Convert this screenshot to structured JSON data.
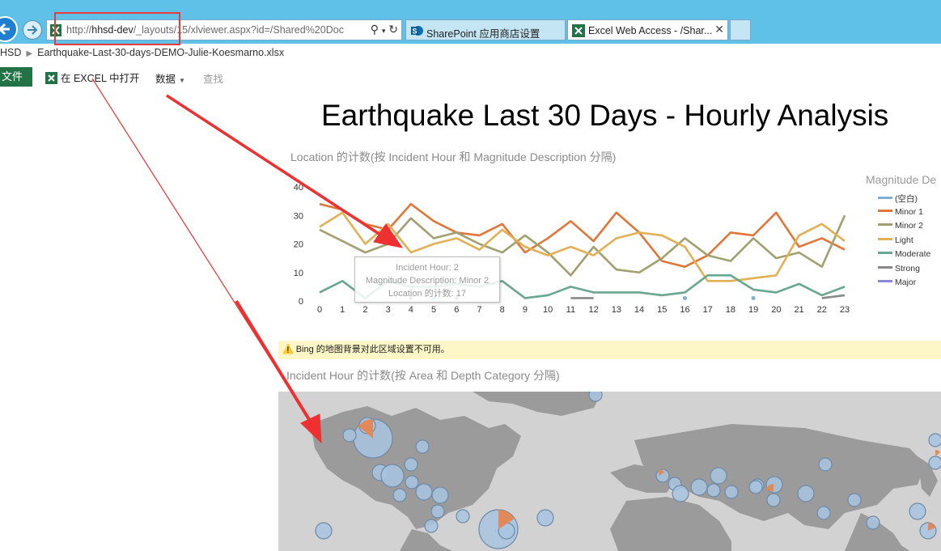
{
  "browser": {
    "address_bar": {
      "url_prefix": "http://",
      "url_host": "hhsd-dev",
      "url_rest": "/_layouts/15/xlviewer.aspx?id=/Shared%20Doc"
    },
    "tabs": [
      {
        "label": "SharePoint 应用商店设置",
        "active": false
      },
      {
        "label": "Excel Web Access - /Shar...",
        "active": true
      }
    ]
  },
  "breadcrumb": {
    "root": "HSD",
    "file": "Earthquake-Last-30-days-DEMO-Julie-Koesmarno.xlsx"
  },
  "ribbon": {
    "file_label": "文件",
    "open_in_excel": "在 EXCEL 中打开",
    "data_menu": "数据",
    "find": "查找"
  },
  "report": {
    "title": "Earthquake Last 30 Days - Hourly Analysis"
  },
  "chart_data": [
    {
      "type": "line",
      "title": "Location 的计数(按 Incident Hour 和 Magnitude Description 分隔)",
      "legend_title": "Magnitude De",
      "legend_placement": "right",
      "x": [
        0,
        1,
        2,
        3,
        4,
        5,
        6,
        7,
        8,
        9,
        10,
        11,
        12,
        13,
        14,
        15,
        16,
        17,
        18,
        19,
        20,
        21,
        22,
        23
      ],
      "ylim": [
        0,
        40
      ],
      "yticks": [
        0,
        10,
        20,
        30,
        40
      ],
      "grid": false,
      "series": [
        {
          "name": "(空白)",
          "color": "#7fb0d1",
          "points": [
            [
              5,
              1
            ],
            [
              16,
              1
            ],
            [
              19,
              1
            ]
          ]
        },
        {
          "name": "Minor 1",
          "color": "#e0773a",
          "points": [
            [
              0,
              34
            ],
            [
              1,
              32
            ],
            [
              2,
              27
            ],
            [
              3,
              25
            ],
            [
              4,
              34
            ],
            [
              5,
              28
            ],
            [
              6,
              24
            ],
            [
              7,
              23
            ],
            [
              8,
              27
            ],
            [
              9,
              17
            ],
            [
              10,
              22
            ],
            [
              11,
              28
            ],
            [
              12,
              21
            ],
            [
              13,
              31
            ],
            [
              14,
              24
            ],
            [
              15,
              14
            ],
            [
              16,
              12
            ],
            [
              17,
              16
            ],
            [
              18,
              24
            ],
            [
              19,
              23
            ],
            [
              20,
              31
            ],
            [
              21,
              19
            ],
            [
              22,
              22
            ],
            [
              23,
              18
            ],
            [
              24,
              15
            ]
          ]
        },
        {
          "name": "Minor 2",
          "color": "#a0a070",
          "points": [
            [
              0,
              25
            ],
            [
              1,
              21
            ],
            [
              2,
              17
            ],
            [
              3,
              20
            ],
            [
              4,
              29
            ],
            [
              5,
              22
            ],
            [
              6,
              24
            ],
            [
              7,
              20
            ],
            [
              8,
              17
            ],
            [
              9,
              23
            ],
            [
              10,
              17
            ],
            [
              11,
              9
            ],
            [
              12,
              19
            ],
            [
              13,
              11
            ],
            [
              14,
              10
            ],
            [
              15,
              15
            ],
            [
              16,
              22
            ],
            [
              17,
              16
            ],
            [
              18,
              14
            ],
            [
              19,
              22
            ],
            [
              20,
              15
            ],
            [
              21,
              17
            ],
            [
              22,
              12
            ],
            [
              23,
              30
            ]
          ]
        },
        {
          "name": "Light",
          "color": "#e2b055",
          "points": [
            [
              0,
              26
            ],
            [
              1,
              31
            ],
            [
              2,
              20
            ],
            [
              3,
              27
            ],
            [
              4,
              17
            ],
            [
              5,
              20
            ],
            [
              6,
              22
            ],
            [
              7,
              18
            ],
            [
              8,
              25
            ],
            [
              9,
              19
            ],
            [
              10,
              16
            ],
            [
              11,
              19
            ],
            [
              12,
              16
            ],
            [
              13,
              22
            ],
            [
              14,
              24
            ],
            [
              15,
              23
            ],
            [
              16,
              19
            ],
            [
              17,
              7
            ],
            [
              18,
              7
            ],
            [
              19,
              8
            ],
            [
              20,
              9
            ],
            [
              21,
              23
            ],
            [
              22,
              27
            ],
            [
              23,
              21
            ]
          ]
        },
        {
          "name": "Moderate",
          "color": "#6aa690",
          "points": [
            [
              0,
              3
            ],
            [
              1,
              7
            ],
            [
              2,
              1
            ],
            [
              3,
              7
            ],
            [
              4,
              5
            ],
            [
              5,
              5
            ],
            [
              6,
              6
            ],
            [
              7,
              5
            ],
            [
              8,
              7
            ],
            [
              9,
              1
            ],
            [
              10,
              2
            ],
            [
              11,
              5
            ],
            [
              12,
              3
            ],
            [
              13,
              3
            ],
            [
              14,
              3
            ],
            [
              15,
              2
            ],
            [
              16,
              3
            ],
            [
              17,
              9
            ],
            [
              18,
              9
            ],
            [
              19,
              4
            ],
            [
              20,
              3
            ],
            [
              21,
              6
            ],
            [
              22,
              2
            ],
            [
              23,
              5
            ]
          ]
        },
        {
          "name": "Strong",
          "color": "#888888",
          "points": [
            [
              4,
              1
            ],
            [
              6,
              1
            ],
            [
              11,
              1
            ],
            [
              12,
              1
            ],
            [
              22,
              1
            ],
            [
              23,
              2
            ]
          ]
        },
        {
          "name": "Major",
          "color": "#8a86d8",
          "points": []
        }
      ],
      "tooltip": {
        "line1": "Incident Hour: 2",
        "line2": "Magnitude Description: Minor 2",
        "line3": "Location 的计数: 17"
      }
    },
    {
      "type": "map",
      "title": "Incident Hour 的计数(按 Area 和 Depth Category 分隔)"
    }
  ],
  "notice": {
    "text": "Bing 的地图背景对此区域设置不可用。",
    "icon": "warning-icon"
  },
  "colors": {
    "excel_green": "#217346",
    "chrome_blue": "#5fc1e8",
    "annotation_red": "#e53b3b",
    "notice_yellow": "#fdf6c6"
  }
}
